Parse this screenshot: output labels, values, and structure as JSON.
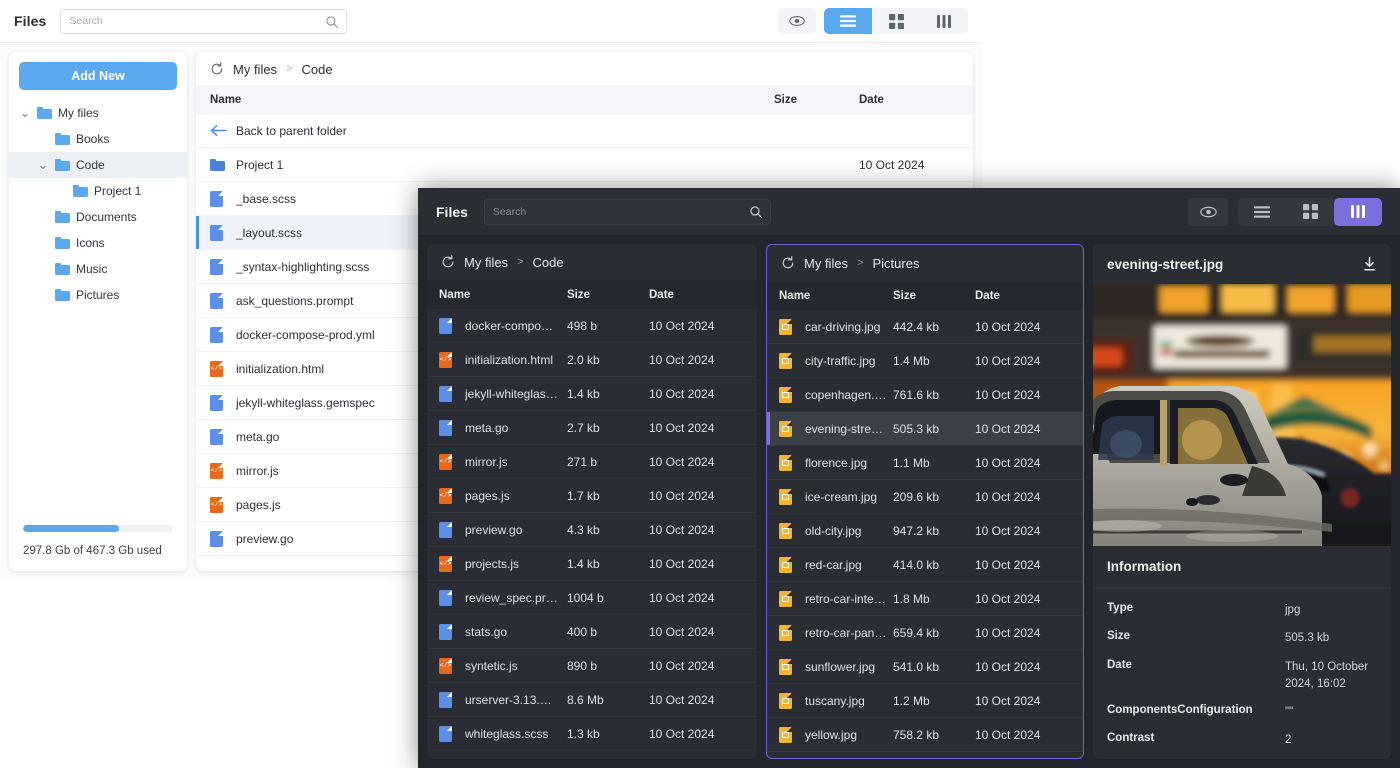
{
  "light_window": {
    "app_title": "Files",
    "search": {
      "value": "",
      "placeholder": "Search"
    },
    "toolbar": {
      "preview_toggle": "eye-icon",
      "view_list": "list-view",
      "view_grid": "grid-view",
      "view_columns": "columns-view",
      "active_view": "list"
    },
    "sidebar": {
      "add_new_label": "Add New",
      "tree": [
        {
          "label": "My files",
          "depth": 0,
          "expanded": true,
          "selected": false
        },
        {
          "label": "Books",
          "depth": 1,
          "expanded": null,
          "selected": false
        },
        {
          "label": "Code",
          "depth": 1,
          "expanded": true,
          "selected": true
        },
        {
          "label": "Project 1",
          "depth": 2,
          "expanded": null,
          "selected": false
        },
        {
          "label": "Documents",
          "depth": 1,
          "expanded": null,
          "selected": false
        },
        {
          "label": "Icons",
          "depth": 1,
          "expanded": null,
          "selected": false
        },
        {
          "label": "Music",
          "depth": 1,
          "expanded": null,
          "selected": false
        },
        {
          "label": "Pictures",
          "depth": 1,
          "expanded": null,
          "selected": false
        }
      ],
      "storage": {
        "percent": 64,
        "text": "297.8 Gb of 467.3 Gb used"
      }
    },
    "breadcrumb": {
      "refresh": "refresh-icon",
      "parts": [
        "My files",
        "Code"
      ],
      "separator": ">"
    },
    "columns": {
      "name": "Name",
      "size": "Size",
      "date": "Date"
    },
    "back_row": {
      "label": "Back to parent folder"
    },
    "rows": [
      {
        "name": "Project 1",
        "size": "",
        "date": "10 Oct 2024",
        "icon": "folder",
        "selected": false
      },
      {
        "name": "_base.scss",
        "size": "",
        "date": "",
        "icon": "doc",
        "selected": false
      },
      {
        "name": "_layout.scss",
        "size": "",
        "date": "",
        "icon": "doc",
        "selected": true
      },
      {
        "name": "_syntax-highlighting.scss",
        "size": "",
        "date": "",
        "icon": "doc",
        "selected": false
      },
      {
        "name": "ask_questions.prompt",
        "size": "",
        "date": "",
        "icon": "doc",
        "selected": false
      },
      {
        "name": "docker-compose-prod.yml",
        "size": "",
        "date": "",
        "icon": "doc",
        "selected": false
      },
      {
        "name": "initialization.html",
        "size": "",
        "date": "",
        "icon": "code",
        "selected": false
      },
      {
        "name": "jekyll-whiteglass.gemspec",
        "size": "",
        "date": "",
        "icon": "doc",
        "selected": false
      },
      {
        "name": "meta.go",
        "size": "",
        "date": "",
        "icon": "doc",
        "selected": false
      },
      {
        "name": "mirror.js",
        "size": "",
        "date": "",
        "icon": "code",
        "selected": false
      },
      {
        "name": "pages.js",
        "size": "",
        "date": "",
        "icon": "code",
        "selected": false
      },
      {
        "name": "preview.go",
        "size": "",
        "date": "",
        "icon": "doc",
        "selected": false
      }
    ]
  },
  "dark_window": {
    "app_title": "Files",
    "search": {
      "value": "",
      "placeholder": "Search"
    },
    "toolbar": {
      "preview_toggle": "eye-icon",
      "view_list": "list-view",
      "view_grid": "grid-view",
      "view_columns": "columns-view",
      "active_view": "columns"
    },
    "panel_code": {
      "breadcrumb": {
        "refresh": "refresh-icon",
        "parts": [
          "My files",
          "Code"
        ],
        "separator": ">"
      },
      "columns": {
        "name": "Name",
        "size": "Size",
        "date": "Date"
      },
      "rows": [
        {
          "name": "docker-compo…",
          "size": "498 b",
          "date": "10 Oct 2024",
          "icon": "doc",
          "selected": false
        },
        {
          "name": "initialization.html",
          "size": "2.0 kb",
          "date": "10 Oct 2024",
          "icon": "code",
          "selected": false
        },
        {
          "name": "jekyll-whiteglas…",
          "size": "1.4 kb",
          "date": "10 Oct 2024",
          "icon": "doc",
          "selected": false
        },
        {
          "name": "meta.go",
          "size": "2.7 kb",
          "date": "10 Oct 2024",
          "icon": "doc",
          "selected": false
        },
        {
          "name": "mirror.js",
          "size": "271 b",
          "date": "10 Oct 2024",
          "icon": "code",
          "selected": false
        },
        {
          "name": "pages.js",
          "size": "1.7 kb",
          "date": "10 Oct 2024",
          "icon": "code",
          "selected": false
        },
        {
          "name": "preview.go",
          "size": "4.3 kb",
          "date": "10 Oct 2024",
          "icon": "doc",
          "selected": false
        },
        {
          "name": "projects.js",
          "size": "1.4 kb",
          "date": "10 Oct 2024",
          "icon": "code",
          "selected": false
        },
        {
          "name": "review_spec.pr…",
          "size": "1004 b",
          "date": "10 Oct 2024",
          "icon": "doc",
          "selected": false
        },
        {
          "name": "stats.go",
          "size": "400 b",
          "date": "10 Oct 2024",
          "icon": "doc",
          "selected": false
        },
        {
          "name": "syntetic.js",
          "size": "890 b",
          "date": "10 Oct 2024",
          "icon": "code",
          "selected": false
        },
        {
          "name": "urserver-3.13.…",
          "size": "8.6 Mb",
          "date": "10 Oct 2024",
          "icon": "doc",
          "selected": false
        },
        {
          "name": "whiteglass.scss",
          "size": "1.3 kb",
          "date": "10 Oct 2024",
          "icon": "doc",
          "selected": false
        }
      ]
    },
    "panel_pictures": {
      "breadcrumb": {
        "refresh": "refresh-icon",
        "parts": [
          "My files",
          "Pictures"
        ],
        "separator": ">"
      },
      "columns": {
        "name": "Name",
        "size": "Size",
        "date": "Date"
      },
      "rows": [
        {
          "name": "car-driving.jpg",
          "size": "442.4 kb",
          "date": "10 Oct 2024",
          "icon": "img",
          "selected": false
        },
        {
          "name": "city-traffic.jpg",
          "size": "1.4 Mb",
          "date": "10 Oct 2024",
          "icon": "img",
          "selected": false
        },
        {
          "name": "copenhagen.jpg",
          "size": "761.6 kb",
          "date": "10 Oct 2024",
          "icon": "img",
          "selected": false
        },
        {
          "name": "evening-street….",
          "size": "505.3 kb",
          "date": "10 Oct 2024",
          "icon": "img",
          "selected": true
        },
        {
          "name": "florence.jpg",
          "size": "1.1 Mb",
          "date": "10 Oct 2024",
          "icon": "img",
          "selected": false
        },
        {
          "name": "ice-cream.jpg",
          "size": "209.6 kb",
          "date": "10 Oct 2024",
          "icon": "img",
          "selected": false
        },
        {
          "name": "old-city.jpg",
          "size": "947.2 kb",
          "date": "10 Oct 2024",
          "icon": "img",
          "selected": false
        },
        {
          "name": "red-car.jpg",
          "size": "414.0 kb",
          "date": "10 Oct 2024",
          "icon": "img",
          "selected": false
        },
        {
          "name": "retro-car-interi…",
          "size": "1.8 Mb",
          "date": "10 Oct 2024",
          "icon": "img",
          "selected": false
        },
        {
          "name": "retro-car-panel…",
          "size": "659.4 kb",
          "date": "10 Oct 2024",
          "icon": "img",
          "selected": false
        },
        {
          "name": "sunflower.jpg",
          "size": "541.0 kb",
          "date": "10 Oct 2024",
          "icon": "img",
          "selected": false
        },
        {
          "name": "tuscany.jpg",
          "size": "1.2 Mb",
          "date": "10 Oct 2024",
          "icon": "img",
          "selected": false
        },
        {
          "name": "yellow.jpg",
          "size": "758.2 kb",
          "date": "10 Oct 2024",
          "icon": "img",
          "selected": false
        }
      ]
    },
    "preview": {
      "filename": "evening-street.jpg",
      "download_icon": "download-icon",
      "image_alt": "evening street scene with vintage car",
      "information_title": "Information",
      "fields": [
        {
          "key": "Type",
          "value": "jpg"
        },
        {
          "key": "Size",
          "value": "505.3 kb"
        },
        {
          "key": "Date",
          "value": "Thu, 10 October 2024, 16:02"
        },
        {
          "key": "ComponentsConfiguration",
          "value": "\"\""
        },
        {
          "key": "Contrast",
          "value": "2"
        }
      ]
    }
  },
  "colors": {
    "light_accent": "#5aa9ef",
    "dark_accent": "#7b6fe0",
    "doc_icon": "#5b8fe8",
    "code_icon": "#e8691c",
    "image_icon": "#f5b335",
    "folder_icon": "#4a82d8"
  }
}
